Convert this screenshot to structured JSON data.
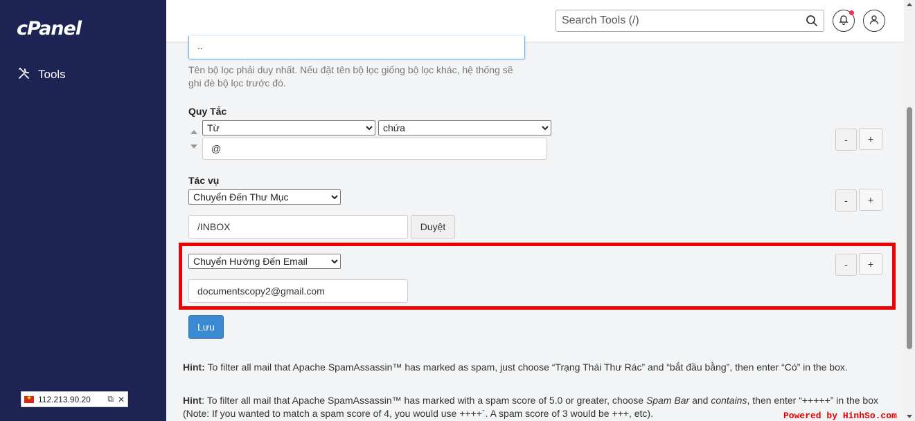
{
  "sidebar": {
    "logo": "cPanel",
    "nav_tools_label": "Tools",
    "ip_address": "112.213.90.20"
  },
  "header": {
    "search_placeholder": "Search Tools (/)"
  },
  "form": {
    "filter_name_value": "..",
    "name_help": "Tên bộ lọc phải duy nhất. Nếu đặt tên bộ lọc giống bộ lọc khác, hệ thống sẽ ghi đè bộ lọc trước đó.",
    "rules_label": "Quy Tắc",
    "rule_field": "Từ",
    "rule_operator": "chứa",
    "rule_value": "@",
    "actions_label": "Tác vụ",
    "action1": "Chuyển Đến Thư Mục",
    "action1_value": "/INBOX",
    "browse_label": "Duyệt",
    "action2": "Chuyển Hướng Đến Email",
    "action2_value": "documentscopy2@gmail.com",
    "minus_label": "-",
    "plus_label": "+",
    "save_label": "Lưu"
  },
  "hints": {
    "hint1_prefix": "Hint:",
    "hint1_text": " To filter all mail that Apache SpamAssassin™ has marked as spam, just choose “Trạng Thái Thư Rác” and “bắt đầu bằng”, then enter “Có” in the box.",
    "hint2_prefix": "Hint",
    "hint2_a": ": To filter all mail that Apache SpamAssassin™ has marked with a spam score of 5.0 or greater, choose ",
    "hint2_spam_bar": "Spam Bar",
    "hint2_and": " and ",
    "hint2_contains": "contains",
    "hint2_b": ", then enter “+++++” in the box (Note: If you wanted to match a spam score of 4, you would use ++++`. A spam score of 3 would be +++, etc)."
  },
  "watermark": "Powered by HinhSo.com",
  "colors": {
    "sidebar_bg": "#1d2454",
    "primary_button": "#3b89d3",
    "highlight_frame": "#ee0000",
    "notification_dot": "#e8344e"
  }
}
